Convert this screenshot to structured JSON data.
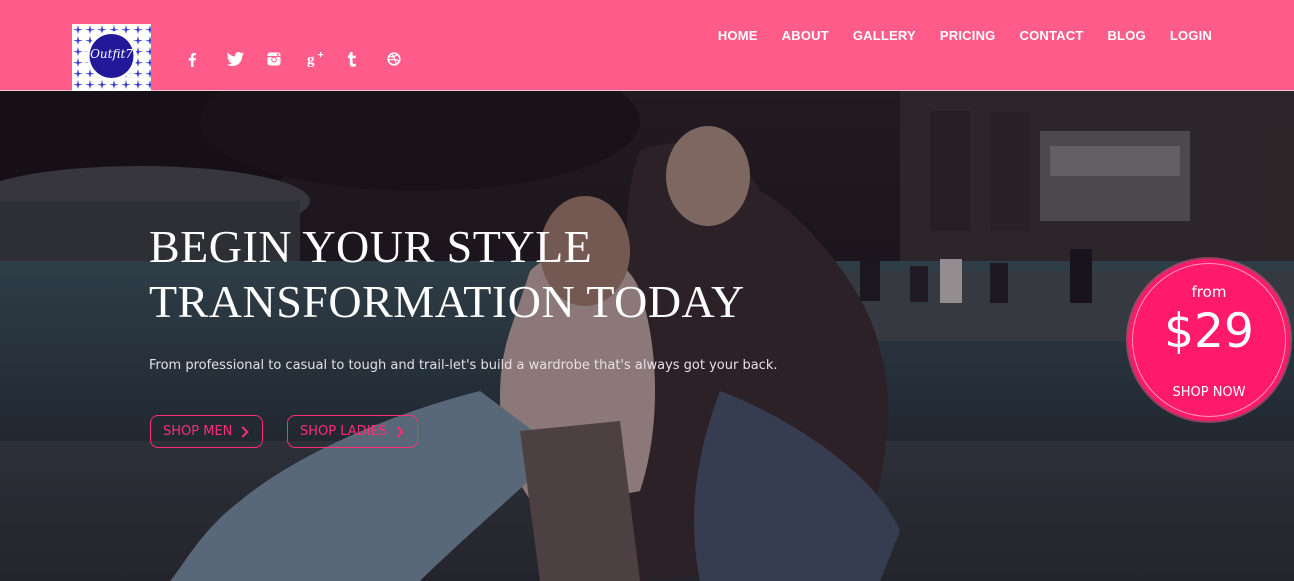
{
  "brand": {
    "logo_text": "Outfit7"
  },
  "colors": {
    "header": "#ff5c8a",
    "accent": "#ff1a6a",
    "cta_border": "#ff2d74"
  },
  "social": [
    {
      "icon": "facebook-icon"
    },
    {
      "icon": "twitter-icon"
    },
    {
      "icon": "instagram-icon"
    },
    {
      "icon": "google-plus-icon"
    },
    {
      "icon": "tumblr-icon"
    },
    {
      "icon": "dribbble-icon"
    }
  ],
  "nav": [
    {
      "label": "HOME"
    },
    {
      "label": "ABOUT"
    },
    {
      "label": "GALLERY"
    },
    {
      "label": "PRICING"
    },
    {
      "label": "CONTACT"
    },
    {
      "label": "BLOG"
    },
    {
      "label": "LOGIN"
    }
  ],
  "hero": {
    "headline_line1": "BEGIN YOUR STYLE",
    "headline_line2": "TRANSFORMATION TODAY",
    "subtext": "From professional to casual to tough and trail-let's build a wardrobe that's always got your back.",
    "cta_men": "SHOP MEN",
    "cta_ladies": "SHOP LADIES"
  },
  "promo": {
    "from": "from",
    "price": "$29",
    "cta": "SHOP NOW"
  }
}
